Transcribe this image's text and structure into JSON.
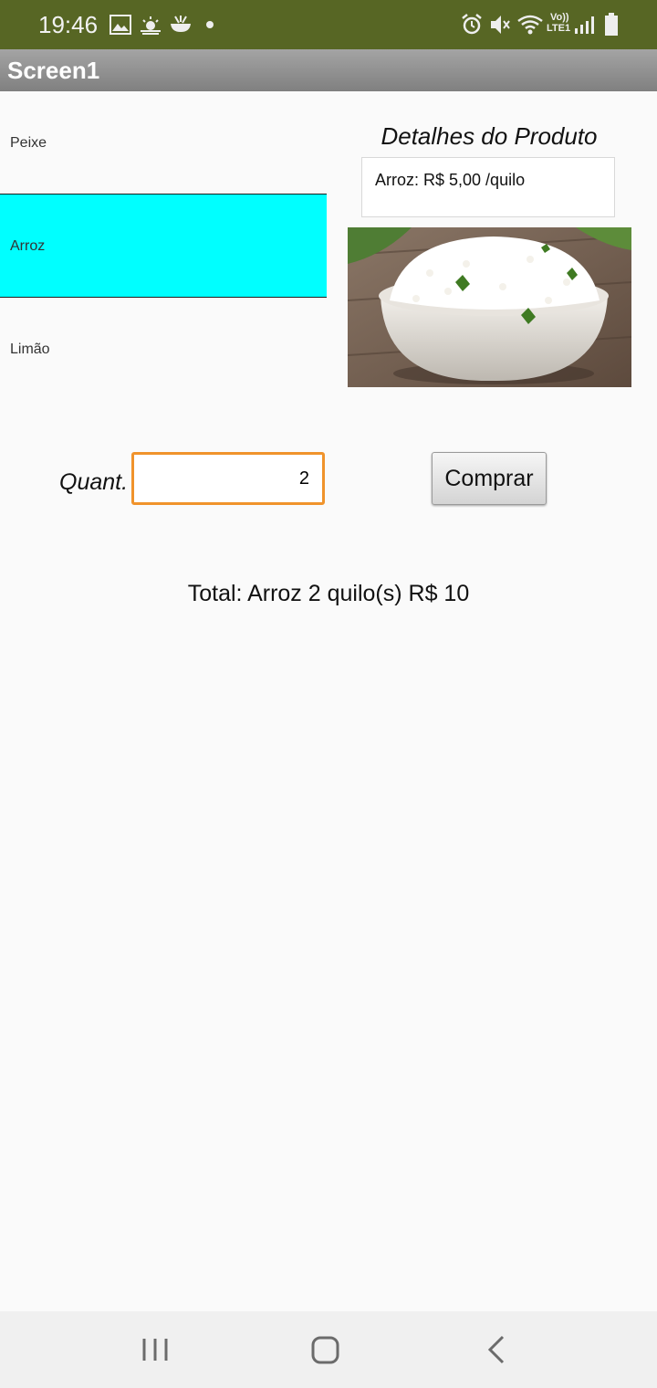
{
  "status_bar": {
    "time": "19:46",
    "left_icons": [
      "image-icon",
      "weather-icon",
      "app-icon",
      "dot-icon"
    ],
    "right_icons": [
      "alarm-icon",
      "mute-icon",
      "wifi-icon",
      "volte-icon",
      "signal-icon",
      "battery-icon"
    ],
    "volte_top": "Vo))",
    "volte_bottom": "LTE1"
  },
  "app": {
    "title": "Screen1"
  },
  "product_list": {
    "items": [
      {
        "label": "Peixe",
        "selected": false
      },
      {
        "label": "Arroz",
        "selected": true
      },
      {
        "label": "Limão",
        "selected": false
      }
    ],
    "selected_color": "#00ffff"
  },
  "details": {
    "title": "Detalhes do Produto",
    "info": "Arroz: R$ 5,00 /quilo",
    "image": "rice-bowl-image"
  },
  "order": {
    "quantity_label": "Quant.",
    "quantity_value": "2",
    "buy_label": "Comprar",
    "total": "Total: Arroz 2 quilo(s) R$ 10"
  },
  "colors": {
    "status_bar": "#576624",
    "title_bar": "#8c8c8c",
    "input_border": "#f0932b"
  },
  "nav_bar": {
    "buttons": [
      "recent-apps-icon",
      "home-icon",
      "back-icon"
    ]
  }
}
